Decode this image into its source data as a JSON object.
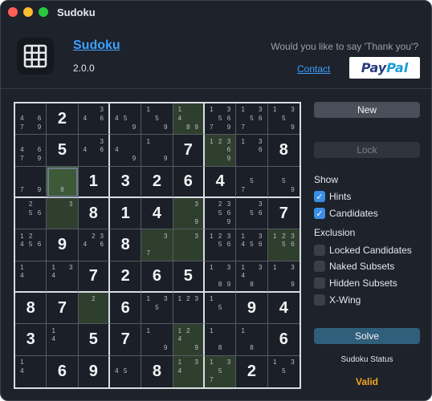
{
  "window": {
    "title": "Sudoku"
  },
  "header": {
    "app_name": "Sudoku",
    "version": "2.0.0",
    "thanks_text": "Would you like to say 'Thank you'?",
    "contact_label": "Contact",
    "paypal_pay": "Pay",
    "paypal_pal": "Pal"
  },
  "icons": {
    "app": "grid-icon",
    "check": "checkmark-icon"
  },
  "colors": {
    "accent": "#3ea1ff",
    "highlight": "#2f3f2e",
    "status": "#f5a623"
  },
  "board": [
    [
      {
        "c": "4 6 7 9"
      },
      {
        "v": "2"
      },
      {
        "c": "3 4 6"
      },
      {
        "c": "4 5 9"
      },
      {
        "c": "1 5 9"
      },
      {
        "c": "1 4 8 9",
        "hl": 1
      },
      {
        "c": "1 3 5 6 7 9"
      },
      {
        "c": "1 3 5 6 7"
      },
      {
        "c": "1 3 5 9"
      }
    ],
    [
      {
        "c": "4 6 7 9"
      },
      {
        "v": "5"
      },
      {
        "c": "3 4 6"
      },
      {
        "c": "4 9"
      },
      {
        "c": "1 9"
      },
      {
        "v": "7"
      },
      {
        "c": "1 2 3 6 9",
        "hl": 1
      },
      {
        "c": "1 3 6"
      },
      {
        "v": "8"
      }
    ],
    [
      {
        "c": "7 9"
      },
      {
        "c": "8",
        "sel": 1
      },
      {
        "v": "1"
      },
      {
        "v": "3"
      },
      {
        "v": "2"
      },
      {
        "v": "6"
      },
      {
        "v": "4"
      },
      {
        "c": "5 7"
      },
      {
        "c": "5 9"
      }
    ],
    [
      {
        "c": "2 5 6"
      },
      {
        "c": "3",
        "hl": 1
      },
      {
        "v": "8"
      },
      {
        "v": "1"
      },
      {
        "v": "4"
      },
      {
        "c": "3 9",
        "hl": 1
      },
      {
        "c": "2 3 5 6 9"
      },
      {
        "c": "3 5 6"
      },
      {
        "v": "7"
      }
    ],
    [
      {
        "c": "1 2 4 5 6"
      },
      {
        "v": "9"
      },
      {
        "c": "2 3 4 6"
      },
      {
        "v": "8"
      },
      {
        "c": "3 7",
        "hl": 1
      },
      {
        "c": "3",
        "hl": 1
      },
      {
        "c": "1 2 3 5 6"
      },
      {
        "c": "1 3 4 5 6"
      },
      {
        "c": "1 2 3 5 6",
        "hl": 1
      }
    ],
    [
      {
        "c": "1 4"
      },
      {
        "c": "1 3 4"
      },
      {
        "v": "7"
      },
      {
        "v": "2"
      },
      {
        "v": "6"
      },
      {
        "v": "5"
      },
      {
        "c": "1 3 8 9"
      },
      {
        "c": "1 3 4 8"
      },
      {
        "c": "1 3 9"
      }
    ],
    [
      {
        "v": "8"
      },
      {
        "v": "7"
      },
      {
        "c": "2",
        "hl": 1
      },
      {
        "v": "6"
      },
      {
        "c": "1 3 5"
      },
      {
        "c": "1 2 3"
      },
      {
        "c": "1 5"
      },
      {
        "v": "9"
      },
      {
        "v": "4"
      }
    ],
    [
      {
        "v": "3"
      },
      {
        "c": "1 4"
      },
      {
        "v": "5"
      },
      {
        "v": "7"
      },
      {
        "c": "1 9"
      },
      {
        "c": "1 2 4 9",
        "hl": 1
      },
      {
        "c": "1 8"
      },
      {
        "c": "1 8"
      },
      {
        "v": "6"
      }
    ],
    [
      {
        "c": "1 4"
      },
      {
        "v": "6"
      },
      {
        "v": "9"
      },
      {
        "c": "4 5"
      },
      {
        "v": "8"
      },
      {
        "c": "1 3 4",
        "hl": 1
      },
      {
        "c": "1 3 5 7",
        "hl": 1
      },
      {
        "v": "2"
      },
      {
        "c": "1 3 5"
      }
    ]
  ],
  "panel": {
    "new_label": "New",
    "lock_label": "Lock",
    "show_title": "Show",
    "hints_label": "Hints",
    "candidates_label": "Candidates",
    "exclusion_title": "Exclusion",
    "locked_label": "Locked Candidates",
    "naked_label": "Naked Subsets",
    "hidden_label": "Hidden Subsets",
    "xwing_label": "X-Wing",
    "solve_label": "Solve",
    "status_label": "Sudoku Status",
    "status_value": "Valid"
  }
}
